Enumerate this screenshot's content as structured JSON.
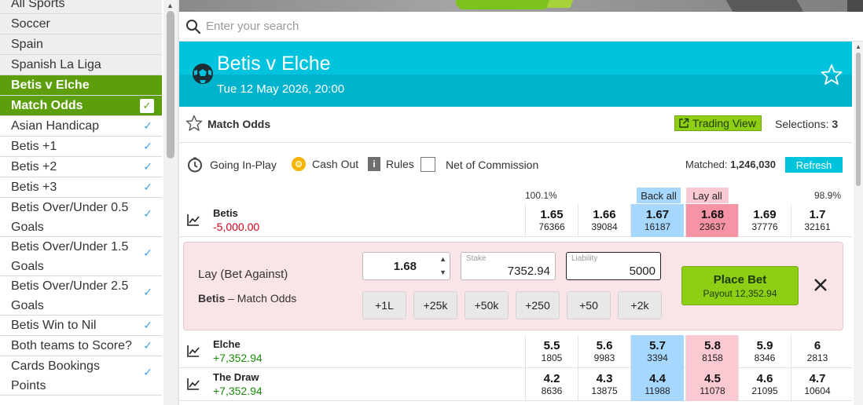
{
  "sidebar": {
    "items": [
      {
        "label": "All Sports",
        "style": "grey"
      },
      {
        "label": "Soccer",
        "style": "grey"
      },
      {
        "label": "Spain",
        "style": "grey"
      },
      {
        "label": "Spanish La Liga",
        "style": "grey"
      },
      {
        "label": "Betis v Elche",
        "style": "green"
      },
      {
        "label": "Match Odds",
        "style": "green",
        "checked": true
      },
      {
        "label": "Asian Handicap",
        "checked": true
      },
      {
        "label": "Betis +1",
        "checked": true
      },
      {
        "label": "Betis +2",
        "checked": true
      },
      {
        "label": "Betis +3",
        "checked": true
      },
      {
        "label": "Betis Over/Under 0.5 Goals",
        "checked": true
      },
      {
        "label": "Betis Over/Under 1.5 Goals",
        "checked": true
      },
      {
        "label": "Betis Over/Under 2.5 Goals",
        "checked": true
      },
      {
        "label": "Betis Win to Nil",
        "checked": true
      },
      {
        "label": "Both teams to Score?",
        "checked": true
      },
      {
        "label": "Cards Bookings Points",
        "checked": true
      }
    ]
  },
  "search": {
    "placeholder": "Enter your search"
  },
  "event": {
    "title": "Betis v Elche",
    "date": "Tue 12 May 2026, 20:00"
  },
  "market": {
    "name": "Match Odds",
    "trading_view_label": "Trading View",
    "selections_label": "Selections:",
    "selections_count": "3"
  },
  "controls": {
    "going_in_play": "Going In-Play",
    "cash_out": "Cash Out",
    "info": "i",
    "rules": "Rules",
    "net_of_commission": "Net of Commission",
    "matched_label": "Matched:",
    "matched_value": "1,246,030",
    "refresh_label": "Refresh"
  },
  "grid": {
    "back_pct": "100.1%",
    "lay_pct": "98.9%",
    "back_all": "Back all",
    "lay_all": "Lay all"
  },
  "runners": [
    {
      "name": "Betis",
      "pl": "-5,000.00",
      "back": [
        [
          "1.65",
          "76366"
        ],
        [
          "1.66",
          "39084"
        ],
        [
          "1.67",
          "16187"
        ]
      ],
      "lay": [
        [
          "1.68",
          "23637"
        ],
        [
          "1.69",
          "37776"
        ],
        [
          "1.7",
          "32161"
        ]
      ]
    },
    {
      "name": "Elche",
      "pl": "+7,352.94",
      "back": [
        [
          "5.5",
          "1805"
        ],
        [
          "5.6",
          "9983"
        ],
        [
          "5.7",
          "3394"
        ]
      ],
      "lay": [
        [
          "5.8",
          "8158"
        ],
        [
          "5.9",
          "8346"
        ],
        [
          "6",
          "2813"
        ]
      ]
    },
    {
      "name": "The Draw",
      "pl": "+7,352.94",
      "back": [
        [
          "4.2",
          "8636"
        ],
        [
          "4.3",
          "13875"
        ],
        [
          "4.4",
          "11988"
        ]
      ],
      "lay": [
        [
          "4.5",
          "11078"
        ],
        [
          "4.6",
          "21095"
        ],
        [
          "4.7",
          "10604"
        ]
      ]
    }
  ],
  "betslip": {
    "type": "Lay (Bet Against)",
    "selection": "Betis",
    "market_suffix": "– Match Odds",
    "odds": "1.68",
    "stake_label": "Stake",
    "stake": "7352.94",
    "liability_label": "Liability",
    "liability": "5000",
    "quick_stakes": [
      "+1L",
      "+25k",
      "+50k",
      "+250",
      "+50",
      "+2k"
    ],
    "place_bet": "Place Bet",
    "payout": "Payout 12,352.94"
  },
  "colors": {
    "accent": "#00c4dd",
    "green": "#5c9e0c",
    "back": "#a6d8ff",
    "lay": "#fac9d1"
  }
}
